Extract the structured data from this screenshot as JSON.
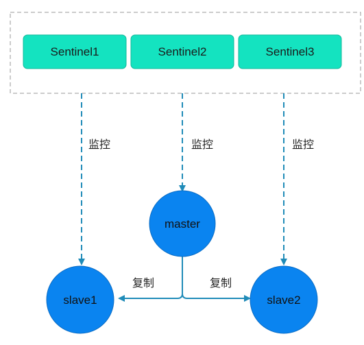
{
  "colors": {
    "sentinel_fill": "#14e3c0",
    "sentinel_stroke": "#0fb89a",
    "node_fill": "#0a84f0",
    "node_stroke": "#0a6cc4",
    "edge": "#1f8bb8",
    "group_border": "#999999"
  },
  "sentinels": [
    {
      "label": "Sentinel1"
    },
    {
      "label": "Sentinel2"
    },
    {
      "label": "Sentinel3"
    }
  ],
  "nodes": {
    "master": {
      "label": "master"
    },
    "slave1": {
      "label": "slave1"
    },
    "slave2": {
      "label": "slave2"
    }
  },
  "edges": {
    "monitor_label": "监控",
    "replicate_label": "复制"
  }
}
